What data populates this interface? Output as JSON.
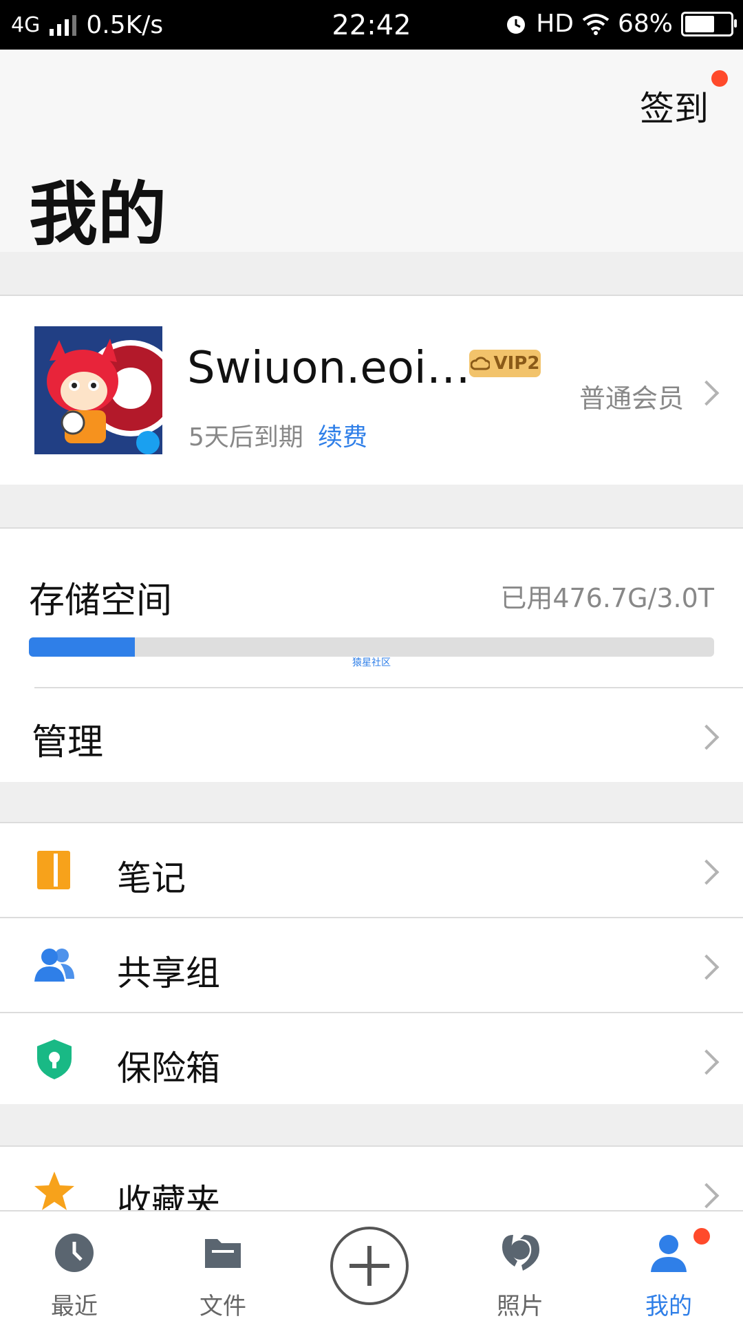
{
  "status_bar": {
    "network": "4G",
    "speed": "0.5K/s",
    "time": "22:42",
    "hd": "HD",
    "battery": "68%",
    "battery_level": 0.68
  },
  "header": {
    "checkin_label": "签到",
    "title": "我的"
  },
  "profile": {
    "username": "Swiuon.eoi…",
    "vip_badge": "VIP2",
    "expire_text": "5天后到期",
    "renew_label": "续费",
    "member_label": "普通会员"
  },
  "storage": {
    "title": "存储空间",
    "used_text": "已用476.7G/3.0T",
    "used_fraction": 0.155,
    "watermark": "猿星社区",
    "manage_label": "管理"
  },
  "list": {
    "items": [
      {
        "label": "笔记",
        "icon": "notebook-icon"
      },
      {
        "label": "共享组",
        "icon": "group-icon"
      },
      {
        "label": "保险箱",
        "icon": "safe-shield-icon"
      }
    ]
  },
  "favorites": {
    "label": "收藏夹",
    "icon": "star-icon"
  },
  "tabs": [
    {
      "label": "最近",
      "icon": "clock-icon"
    },
    {
      "label": "文件",
      "icon": "folder-icon"
    },
    {
      "label": "",
      "icon": "plus-icon"
    },
    {
      "label": "照片",
      "icon": "photo-icon"
    },
    {
      "label": "我的",
      "icon": "user-icon"
    }
  ],
  "colors": {
    "accent": "#2f7fe8",
    "badge_red": "#ff4a2b",
    "notes_orange": "#f7a21b",
    "safe_green": "#19b985"
  }
}
